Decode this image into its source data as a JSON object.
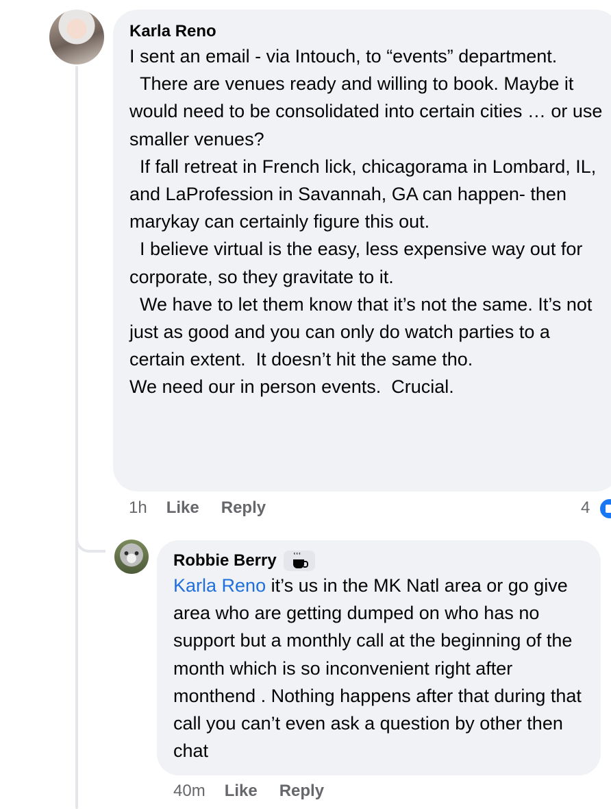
{
  "comments": [
    {
      "author": "Karla Reno",
      "text": "I sent an email - via Intouch, to “events” department.\n  There are venues ready and willing to book. Maybe it would need to be consolidated into certain cities … or use smaller venues?\n  If fall retreat in French lick, chicagorama in Lombard, IL, and LaProfession in Savannah, GA can happen- then marykay can certainly figure this out.\n  I believe virtual is the easy, less expensive way out for corporate, so they gravitate to it.\n  We have to let them know that it’s not the same. It’s not just as good and you can only do watch parties to a certain extent.  It doesn’t hit the same tho.\nWe need our in person events.  Crucial.",
      "time": "1h",
      "like_label": "Like",
      "reply_label": "Reply",
      "reaction_count": "4",
      "reaction_icon": "like-icon"
    },
    {
      "author": "Robbie Berry",
      "badge_icon": "coffee-cup-icon",
      "mention": "Karla Reno",
      "text": " it’s us in the MK Natl area or go give area who are getting dumped on who has no support but a monthly call at the beginning of the month which is so inconvenient right after monthend . Nothing happens after that during that call you can’t even ask a question by other then chat",
      "time": "40m",
      "like_label": "Like",
      "reply_label": "Reply"
    }
  ],
  "colors": {
    "bubble": "#f0f2f5",
    "meta_text": "#65676b",
    "mention": "#216fdb",
    "like_blue": "#1877f2"
  }
}
